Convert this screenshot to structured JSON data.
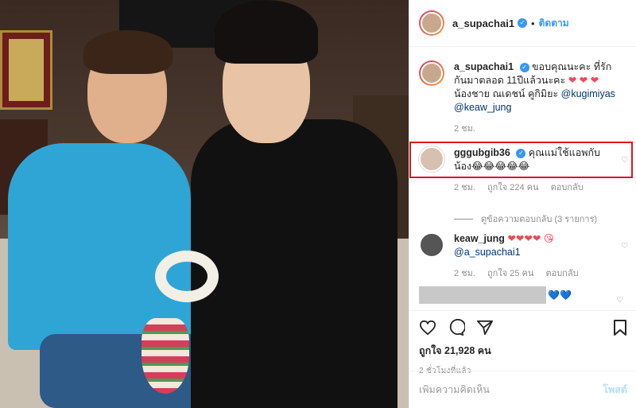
{
  "post": {
    "author": "a_supachai1",
    "follow_label": "ติดตาม",
    "dot": "•"
  },
  "comments": [
    {
      "user": "a_supachai1",
      "text": "ขอบคุณนะคะ ที่รักกันมาตลอด 11ปีแล้วนะคะ ",
      "hearts": "❤ ❤ ❤",
      "text2": " น้องชาย ณเดชน์ คูกิมิยะ ",
      "mention1": "@kugimiyas",
      "mention2": "@keaw_jung",
      "time": "2 ชม."
    },
    {
      "user": "gggubgib36",
      "text": "คุณแม่ใช้แอพกับน้อง😂😂😂😂😂",
      "time": "2 ชม.",
      "likes": "ถูกใจ 224 คน",
      "reply": "ตอบกลับ",
      "view_replies": "ดูข้อความตอบกลับ (3 รายการ)"
    },
    {
      "user": "keaw_jung",
      "text": "❤❤❤❤ 😘",
      "mention": "@a_supachai1",
      "time": "2 ชม.",
      "likes": "ถูกใจ 25 คน",
      "reply": "ตอบกลับ"
    },
    {
      "hidden_text": "💙💙"
    }
  ],
  "actions": {
    "likes": "ถูกใจ 21,928 คน",
    "time_ago": "2 ชั่วโมงที่แล้ว"
  },
  "add_comment": {
    "placeholder": "เพิ่มความคิดเห็น",
    "post_label": "โพสต์"
  },
  "colors": {
    "accent": "#3897f0",
    "highlight_border": "#e0161e",
    "heart": "#ed4956"
  }
}
